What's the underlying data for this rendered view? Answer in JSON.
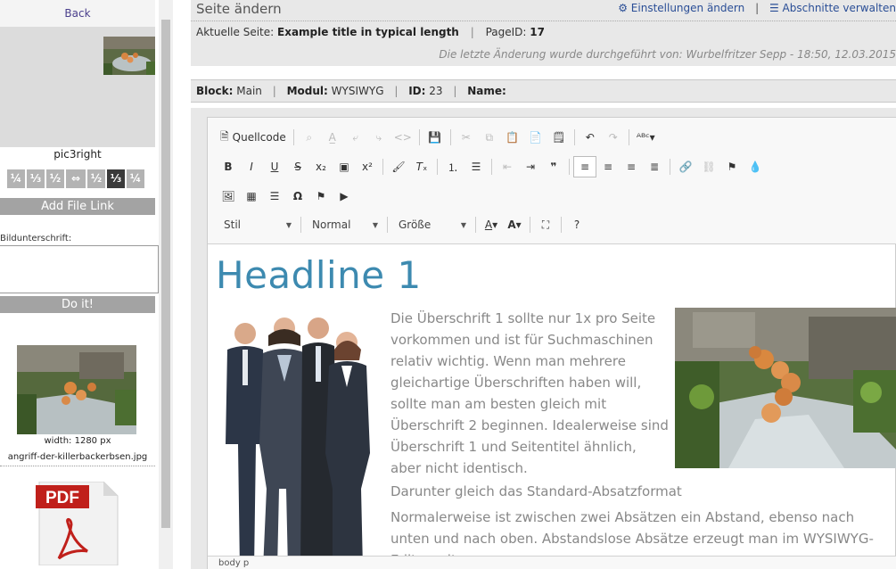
{
  "sidebar": {
    "back_label": "Back",
    "picture_name": "pic3right",
    "align_buttons": [
      "¼",
      "⅓",
      "½",
      "⇔",
      "½",
      "⅓",
      "¼"
    ],
    "add_file_link": "Add File Link",
    "caption_label": "Bildunterschrift:",
    "caption_value": "",
    "do_it": "Do it!",
    "file_width": "width: 1280 px",
    "file_name": "angriff-der-killerbackerbsen.jpg",
    "pdf_label": "PDF"
  },
  "header": {
    "title": "Seite ändern",
    "settings_link": "Einstellungen ändern",
    "sections_link": "Abschnitte verwalten",
    "current_page_label": "Aktuelle Seite:",
    "current_page_value": "Example title in typical length",
    "page_id_label": "PageID:",
    "page_id_value": "17",
    "last_change": "Die letzte Änderung wurde durchgeführt von: Wurbelfritzer Sepp - 18:50, 12.03.2015"
  },
  "block_bar": {
    "block_label": "Block:",
    "block_value": "Main",
    "modul_label": "Modul:",
    "modul_value": "WYSIWYG",
    "id_label": "ID:",
    "id_value": "23",
    "name_label": "Name:"
  },
  "editor": {
    "source_label": "Quellcode",
    "style_combo": "Stil",
    "format_combo": "Normal",
    "size_combo": "Größe",
    "help": "?",
    "headline": "Headline 1",
    "paragraph1": "Die Überschrift 1 sollte nur 1x pro Seite vorkommen und ist für Suchmaschinen relativ wichtig. Wenn man mehrere gleichartige Überschriften haben will, sollte man am besten gleich mit Überschrift 2 beginnen. Idealerweise sind Überschrift 1 und Seitentitel ähnlich, aber nicht identisch.",
    "paragraph2": "Darunter gleich das Standard-Absatzformat",
    "paragraph3": "Normalerweise ist zwischen zwei Absätzen ein Abstand, ebenso nach unten und nach oben. Abstandslose Absätze erzeugt man im WYSIWYG-Editor mit",
    "path": "body  p"
  },
  "colors": {
    "headline": "#3d8ab0",
    "link": "#2a4e96",
    "sidebar_button": "#a3a3a3"
  }
}
